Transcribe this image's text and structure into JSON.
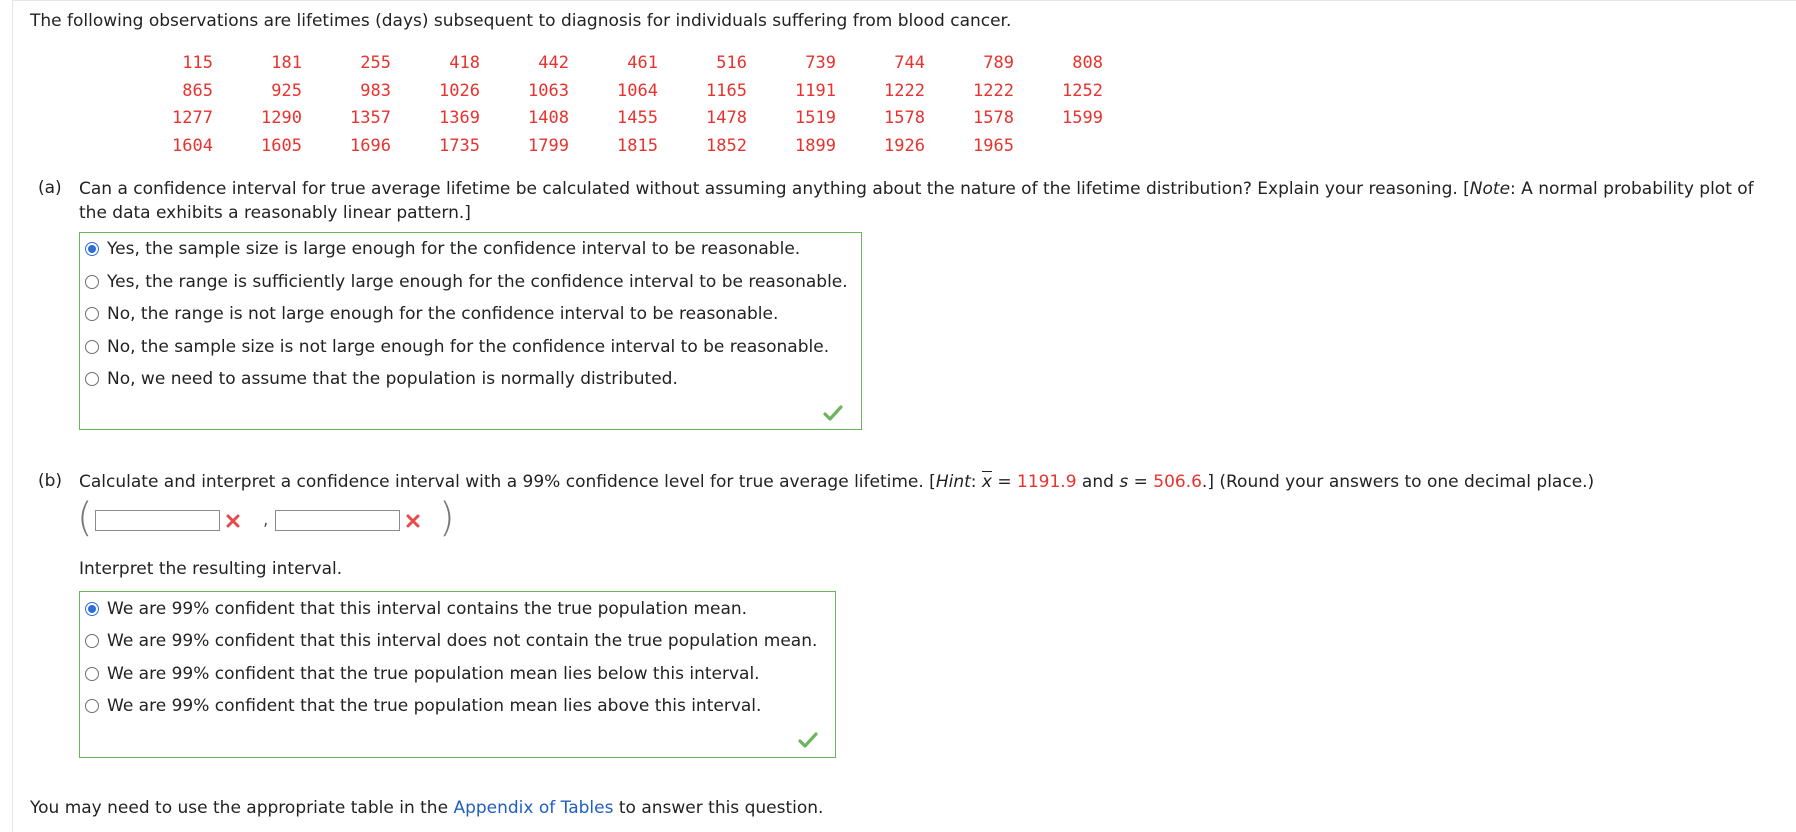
{
  "intro": "The following observations are lifetimes (days) subsequent to diagnosis for individuals suffering from blood cancer.",
  "data_rows": [
    [
      "115",
      "181",
      "255",
      "418",
      "442",
      "461",
      "516",
      "739",
      "744",
      "789",
      "808"
    ],
    [
      "865",
      "925",
      "983",
      "1026",
      "1063",
      "1064",
      "1165",
      "1191",
      "1222",
      "1222",
      "1252"
    ],
    [
      "1277",
      "1290",
      "1357",
      "1369",
      "1408",
      "1455",
      "1478",
      "1519",
      "1578",
      "1578",
      "1599"
    ],
    [
      "1604",
      "1605",
      "1696",
      "1735",
      "1799",
      "1815",
      "1852",
      "1899",
      "1926",
      "1965"
    ]
  ],
  "part_a": {
    "label": "(a)",
    "question_start": "Can a confidence interval for true average lifetime be calculated without assuming anything about the nature of the lifetime distribution? Explain your reasoning. [",
    "note_word": "Note",
    "question_end": ": A normal probability plot of the data exhibits a reasonably linear pattern.]",
    "options": [
      "Yes, the sample size is large enough for the confidence interval to be reasonable.",
      "Yes, the range is sufficiently large enough for the confidence interval to be reasonable.",
      "No, the range is not large enough for the confidence interval to be reasonable.",
      "No, the sample size is not large enough for the confidence interval to be reasonable.",
      "No, we need to assume that the population is normally distributed."
    ],
    "selected_index": 0,
    "status": "correct-check-icon"
  },
  "part_b": {
    "label": "(b)",
    "question_start": "Calculate and interpret a confidence interval with a 99% confidence level for true average lifetime. [",
    "hint_word": "Hint",
    "xbar_symbol": "x",
    "eq1": " = ",
    "xbar_value": "1191.9",
    "and_word": " and ",
    "s_symbol": "s",
    "eq2": " = ",
    "s_value": "506.6",
    "question_end": ".] (Round your answers to one decimal place.)",
    "lower_value": "",
    "upper_value": "",
    "separator": ",",
    "interpret_label": "Interpret the resulting interval.",
    "options": [
      "We are 99% confident that this interval contains the true population mean.",
      "We are 99% confident that this interval does not contain the true population mean.",
      "We are 99% confident that the true population mean lies below this interval.",
      "We are 99% confident that the true population mean lies above this interval."
    ],
    "selected_index": 0,
    "status": "correct-check-icon"
  },
  "footer": {
    "prefix": "You may need to use the appropriate table in the ",
    "link": "Appendix of Tables",
    "suffix": " to answer this question."
  },
  "colors": {
    "data_red": "#e8322e",
    "box_green": "#6bb55c",
    "radio_blue": "#2b6fd8",
    "link_blue": "#1f5fbf",
    "error_red": "#e84a4a"
  }
}
